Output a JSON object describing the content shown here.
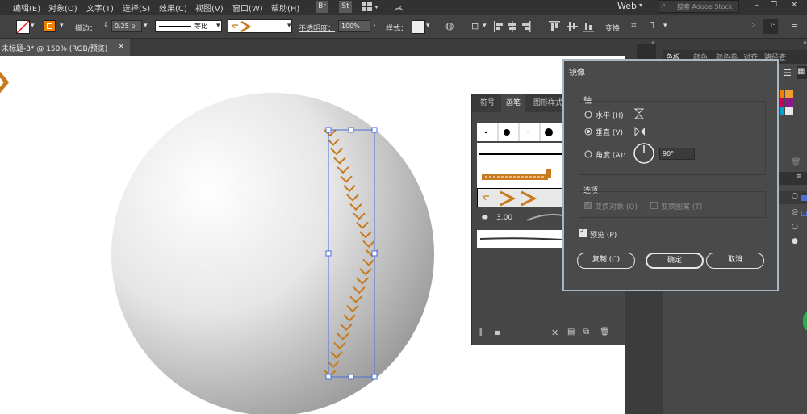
{
  "menubar": {
    "items": [
      "编辑(E)",
      "对象(O)",
      "文字(T)",
      "选择(S)",
      "效果(C)",
      "视图(V)",
      "窗口(W)",
      "帮助(H)"
    ],
    "bridge": "Br",
    "stock": "St",
    "workspace": "Web",
    "search_placeholder": "搜索 Adobe Stock"
  },
  "control_bar": {
    "stroke_label": "描边：",
    "stroke_value": "0.25 p",
    "profile_label": "等比",
    "opacity_label": "不透明度：",
    "opacity_value": "100%",
    "style_label": "样式：",
    "transform_label": "变换"
  },
  "document_tab": {
    "title": "未标题-3* @ 150% (RGB/预览)",
    "close": "×"
  },
  "brush_panel": {
    "tabs": [
      "符号",
      "画笔",
      "图形样式"
    ],
    "active_tab": "画笔",
    "size_value": "3.00"
  },
  "dialog": {
    "title": "镜像",
    "axis_heading": "轴",
    "horizontal_label": "水平 (H)",
    "vertical_label": "垂直 (V)",
    "angle_label": "角度 (A):",
    "angle_value": "90°",
    "selected_axis": "vertical",
    "options_heading": "选项",
    "transform_objects": "变换对象 (O)",
    "transform_patterns": "变换图案 (T)",
    "preview_label": "预览 (P)",
    "preview_checked": true,
    "copy_button": "复制 (C)",
    "ok_button": "确定",
    "cancel_button": "取消"
  },
  "right_panel": {
    "tabs": [
      "色板",
      "颜色",
      "颜色参",
      "对齐",
      "路径查"
    ],
    "active_tab": "色板"
  },
  "colors": {
    "accent_brush": "#c87a1e",
    "selection": "#4a6fd8",
    "dialog_border": "#a9b6c4"
  }
}
